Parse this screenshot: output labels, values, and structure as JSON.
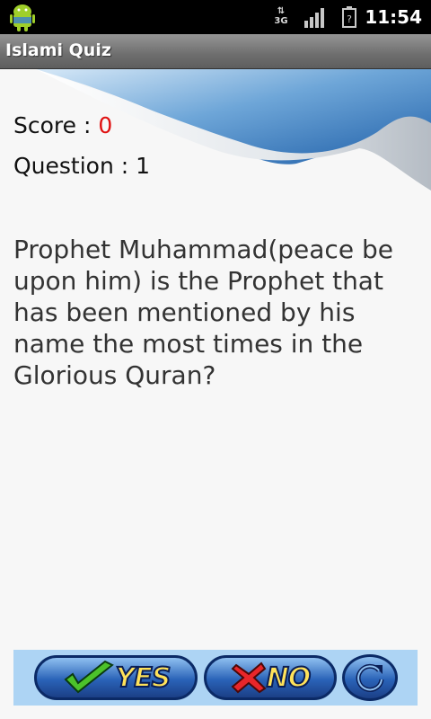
{
  "status_bar": {
    "network": "3G",
    "time": "11:54",
    "icons": [
      "android-app-icon",
      "data-transfer-icon",
      "signal-icon",
      "battery-icon"
    ]
  },
  "title_bar": {
    "title": "Islami Quiz"
  },
  "quiz": {
    "score_label": "Score : ",
    "score_value": "0",
    "question_label": "Question : 1",
    "question_text": "Prophet Muhammad(peace be upon him) is the Prophet that has been mentioned by his name the most times in the Glorious Quran?"
  },
  "buttons": {
    "yes_label": "YES",
    "no_label": "NO",
    "reset_icon": "refresh-icon"
  },
  "colors": {
    "score_value": "#e01010",
    "button_bar": "#add4f4",
    "button_fill": "#2a63b8",
    "button_text": "#ffe25a"
  }
}
